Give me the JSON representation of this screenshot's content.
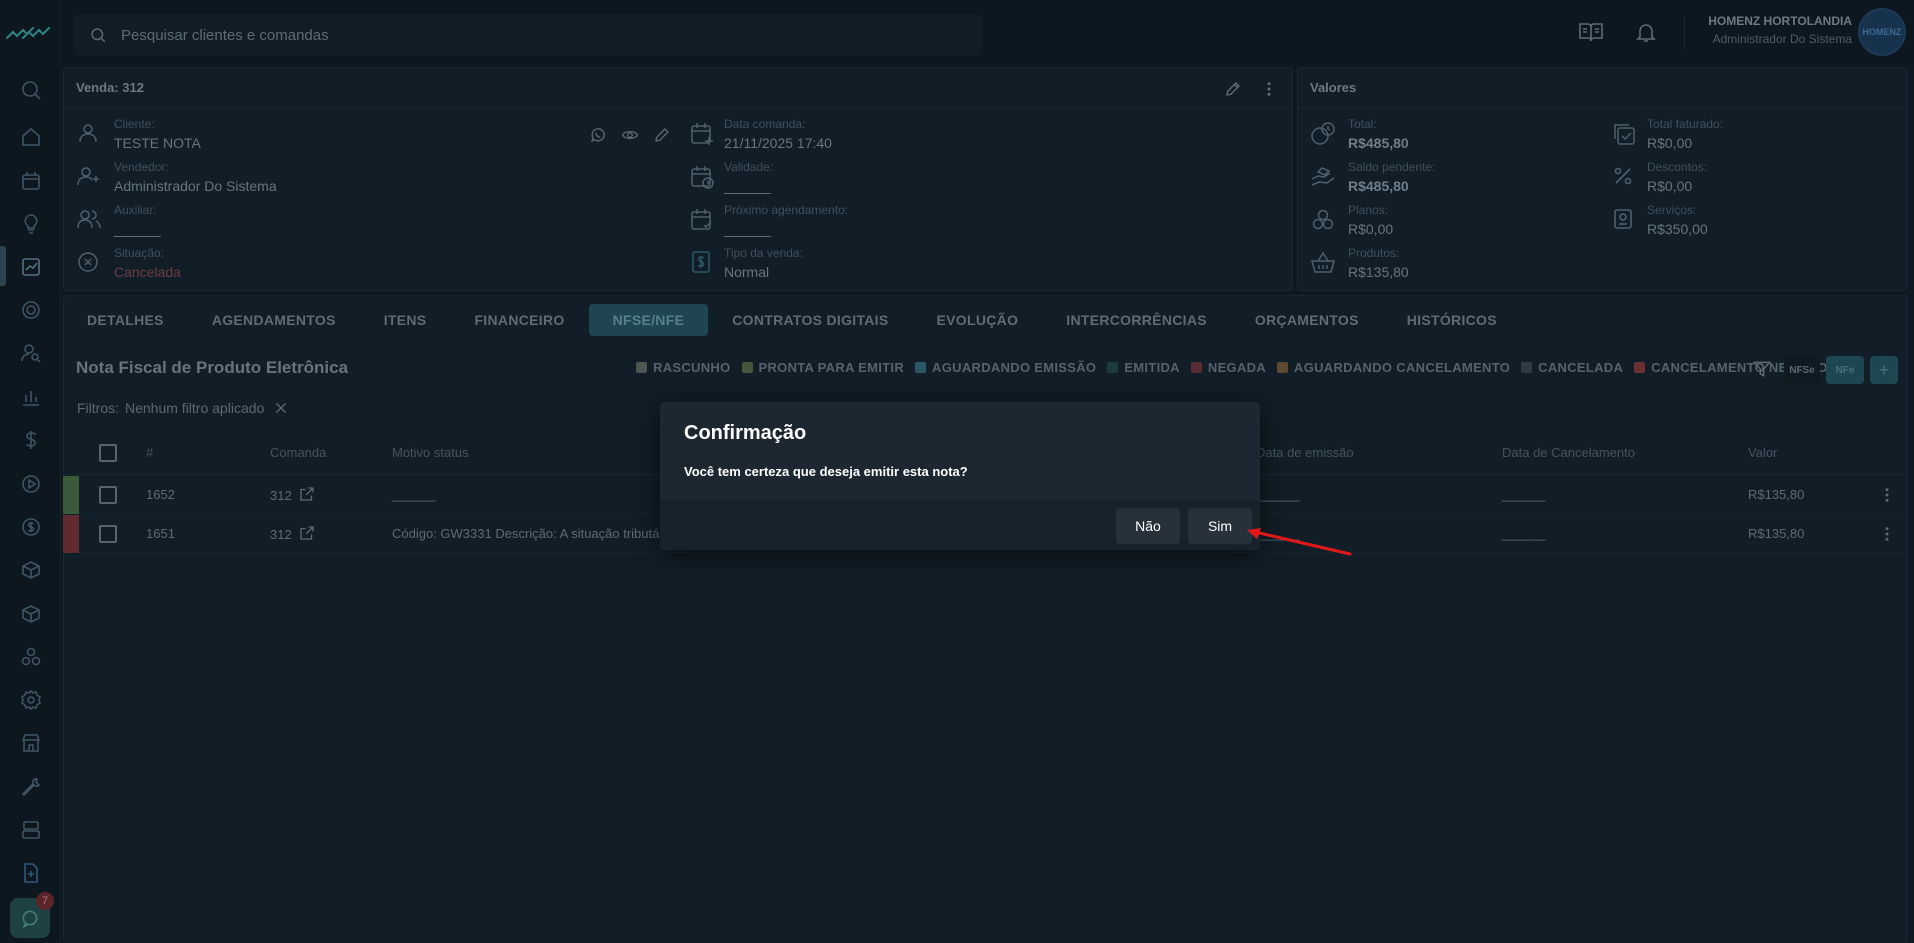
{
  "search": {
    "placeholder": "Pesquisar clientes e comandas"
  },
  "user": {
    "name": "HOMENZ HORTOLANDIA",
    "role": "Administrador Do Sistema",
    "avatar_text": "HOMENZ"
  },
  "chat": {
    "badge": "7"
  },
  "venda": {
    "title": "Venda: 312",
    "cliente_label": "Cliente:",
    "cliente": "TESTE NOTA",
    "vendedor_label": "Vendedor:",
    "vendedor": "Administrador Do Sistema",
    "auxiliar_label": "Auxiliar:",
    "auxiliar": "______",
    "situacao_label": "Situação:",
    "situacao": "Cancelada",
    "data_label": "Data comanda:",
    "data": "21/11/2025 17:40",
    "validade_label": "Validade:",
    "validade": "______",
    "proximo_label": "Próximo agendamento:",
    "proximo": "______",
    "tipo_label": "Tipo da venda:",
    "tipo": "Normal"
  },
  "valores": {
    "title": "Valores",
    "total_label": "Total:",
    "total": "R$485,80",
    "saldo_label": "Saldo pendente:",
    "saldo": "R$485,80",
    "planos_label": "Planos:",
    "planos": "R$0,00",
    "produtos_label": "Produtos:",
    "produtos": "R$135,80",
    "faturado_label": "Total faturado:",
    "faturado": "R$0,00",
    "descontos_label": "Descontos:",
    "descontos": "R$0,00",
    "servicos_label": "Serviços:",
    "servicos": "R$350,00"
  },
  "tabs": [
    "DETALHES",
    "AGENDAMENTOS",
    "ITENS",
    "FINANCEIRO",
    "NFSE/NFE",
    "CONTRATOS DIGITAIS",
    "EVOLUÇÃO",
    "INTERCORRÊNCIAS",
    "ORÇAMENTOS",
    "HISTÓRICOS"
  ],
  "content": {
    "title": "Nota Fiscal de Produto Eletrônica",
    "legend": [
      {
        "label": "RASCUNHO",
        "color": "#4c5752"
      },
      {
        "label": "PRONTA PARA EMITIR",
        "color": "#45563a"
      },
      {
        "label": "AGUARDANDO EMISSÃO",
        "color": "#2c5666"
      },
      {
        "label": "EMITIDA",
        "color": "#1b3b3d"
      },
      {
        "label": "NEGADA",
        "color": "#5a2b33"
      },
      {
        "label": "AGUARDANDO CANCELAMENTO",
        "color": "#5f4a2f"
      },
      {
        "label": "CANCELADA",
        "color": "#2f3a43"
      },
      {
        "label": "CANCELAMENTO NEGADO",
        "color": "#6b2f35"
      }
    ],
    "nfse_chip": "NFSe",
    "nfe_chip": "NFe",
    "add_chip": "+",
    "filters_label": "Filtros:",
    "filters_value": "Nenhum filtro aplicado"
  },
  "table": {
    "columns": [
      "#",
      "Comanda",
      "Motivo status",
      "Data de emissão",
      "Data de Cancelamento",
      "Valor"
    ],
    "rows": [
      {
        "id": "1652",
        "comanda": "312",
        "motivo": "______",
        "emissao": "______",
        "cancelamento": "______",
        "valor": "R$135,80",
        "status_color": "#3b5a3a"
      },
      {
        "id": "1651",
        "comanda": "312",
        "motivo": "Código: GW3331 Descrição: A situação tributá",
        "emissao": "______",
        "cancelamento": "______",
        "valor": "R$135,80",
        "status_color": "#5f2a30"
      }
    ]
  },
  "modal": {
    "title": "Confirmação",
    "message": "Você tem certeza que deseja emitir esta nota?",
    "no": "Não",
    "yes": "Sim"
  }
}
